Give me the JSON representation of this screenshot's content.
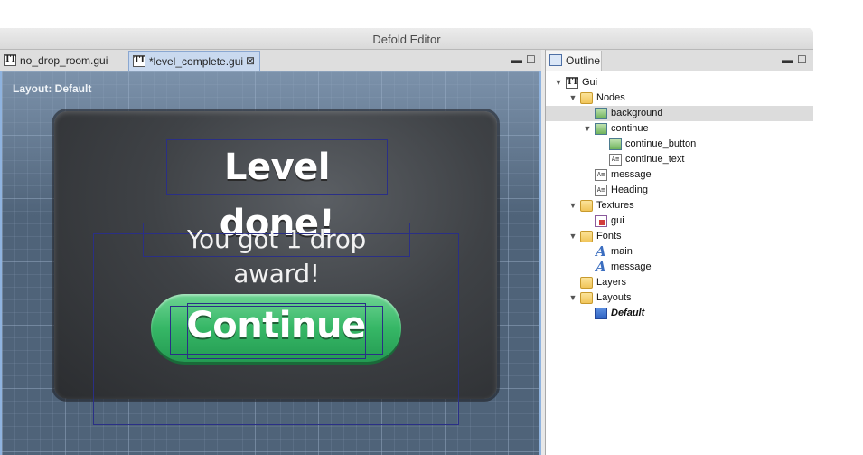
{
  "window": {
    "title": "Defold Editor"
  },
  "editor": {
    "tabs": [
      {
        "label": "no_drop_room.gui",
        "icon": "gui-file-icon"
      },
      {
        "label": "*level_complete.gui",
        "icon": "gui-file-icon",
        "close": "⊠"
      }
    ],
    "pane_controls": {
      "minimize": "▬",
      "maximize": "☐"
    },
    "layout_label": "Layout: Default",
    "scene": {
      "heading": "Level done!",
      "message": "You got 1 drop award!",
      "button_text": "Continue"
    }
  },
  "outline": {
    "tab_label": "Outline",
    "pane_controls": {
      "minimize": "▬",
      "maximize": "☐"
    },
    "tree": [
      {
        "label": "Gui",
        "icon": "gui-root-icon",
        "expanded": true,
        "level": 0
      },
      {
        "label": "Nodes",
        "icon": "folder-icon",
        "expanded": true,
        "level": 1
      },
      {
        "label": "background",
        "icon": "box-node-icon",
        "level": 2,
        "selected": true
      },
      {
        "label": "continue",
        "icon": "box-node-icon",
        "expanded": true,
        "level": 2
      },
      {
        "label": "continue_button",
        "icon": "box-node-icon",
        "level": 3
      },
      {
        "label": "continue_text",
        "icon": "text-node-icon",
        "level": 3
      },
      {
        "label": "message",
        "icon": "text-node-icon",
        "level": 2
      },
      {
        "label": "Heading",
        "icon": "text-node-icon",
        "level": 2
      },
      {
        "label": "Textures",
        "icon": "folder-icon",
        "expanded": true,
        "level": 1
      },
      {
        "label": "gui",
        "icon": "texture-icon",
        "level": 2
      },
      {
        "label": "Fonts",
        "icon": "folder-icon",
        "expanded": true,
        "level": 1
      },
      {
        "label": "main",
        "icon": "font-icon",
        "level": 2
      },
      {
        "label": "message",
        "icon": "font-icon",
        "level": 2
      },
      {
        "label": "Layers",
        "icon": "folder-icon",
        "level": 1
      },
      {
        "label": "Layouts",
        "icon": "folder-icon",
        "expanded": true,
        "level": 1
      },
      {
        "label": "Default",
        "icon": "layout-icon",
        "level": 2,
        "emphasis": true
      }
    ]
  },
  "colors": {
    "canvas_bg": "#4f6379",
    "selection_border": "#2a2f86",
    "button_green": "#36b766",
    "active_tab": "#c9d9ef"
  }
}
